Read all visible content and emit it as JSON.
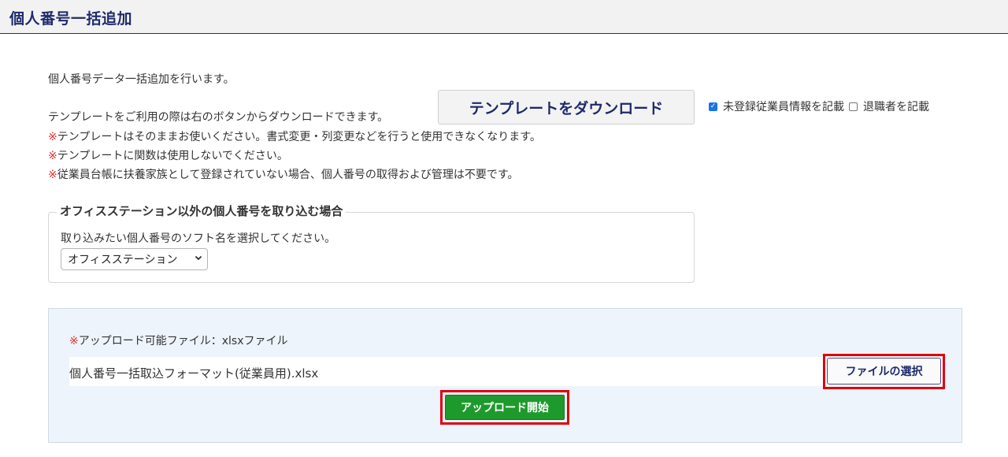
{
  "header": {
    "title": "個人番号一括追加"
  },
  "intro": {
    "line1": "個人番号データ一括追加を行います。",
    "line2": "テンプレートをご利用の際は右のボタンからダウンロードできます。",
    "template_button": "テンプレートをダウンロード",
    "notes": [
      {
        "mark": "※",
        "text": "テンプレートはそのままお使いください。書式変更・列変更などを行うと使用できなくなります。"
      },
      {
        "mark": "※",
        "text": "テンプレートに関数は使用しないでください。"
      },
      {
        "mark": "※",
        "text": "従業員台帳に扶養家族として登録されていない場合、個人番号の取得および管理は不要です。"
      }
    ]
  },
  "options": {
    "unregistered_label": "未登録従業員情報を記載",
    "unregistered_checked": true,
    "retired_label": "退職者を記載",
    "retired_checked": false
  },
  "import_section": {
    "legend": "オフィスステーション以外の個人番号を取り込む場合",
    "instruction": "取り込みたい個人番号のソフト名を選択してください。",
    "selected_software": "オフィスステーション"
  },
  "upload": {
    "allowed_mark": "※",
    "allowed_text": "アップロード可能ファイル：xlsxファイル",
    "file_name": "個人番号一括取込フォーマット(従業員用).xlsx",
    "choose_file_button": "ファイルの選択",
    "start_button": "アップロード開始"
  },
  "colors": {
    "accent_navy": "#1f2a6b",
    "note_red": "#e03030",
    "upload_green": "#1e9a2c",
    "highlight_red": "#e0000d"
  }
}
